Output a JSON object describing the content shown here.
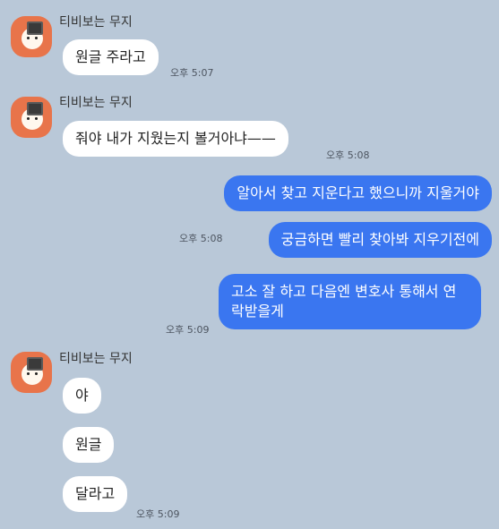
{
  "sender": {
    "name": "티비보는 무지"
  },
  "messages": [
    {
      "side": "in",
      "text": "원글 주라고",
      "time": "오후 5:07"
    },
    {
      "side": "in",
      "text": "줘야 내가 지웠는지 볼거아냐——",
      "time": "오후 5:08"
    },
    {
      "side": "out",
      "text": "알아서 찾고 지운다고 했으니까 지울거야"
    },
    {
      "side": "out",
      "text": "궁금하면 빨리 찾아봐 지우기전에",
      "time": "오후 5:08"
    },
    {
      "side": "out",
      "text": "고소 잘 하고 다음엔 변호사 통해서 연락받을게",
      "time": "오후 5:09"
    },
    {
      "side": "in",
      "text": "야"
    },
    {
      "side": "in",
      "text": "원글"
    },
    {
      "side": "in",
      "text": "달라고",
      "time": "오후 5:09"
    }
  ],
  "colors": {
    "background": "#b9c8d8",
    "incoming_bubble": "#ffffff",
    "outgoing_bubble": "#3a76f0"
  },
  "icons": {
    "avatar": "muzi-watching-tv-avatar-icon"
  }
}
